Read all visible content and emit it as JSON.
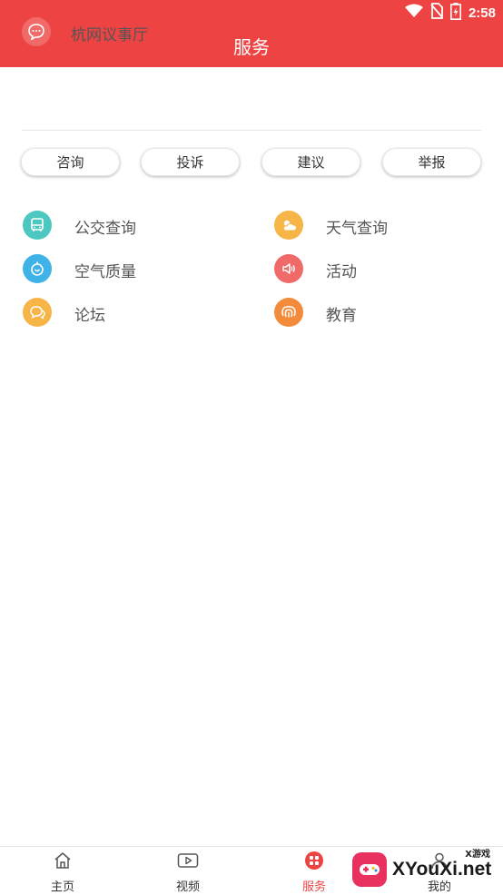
{
  "status_bar": {
    "time": "2:58"
  },
  "header": {
    "title": "服务"
  },
  "hall": {
    "label": "杭网议事厅",
    "icon": "chat-bubble-icon",
    "color": "#f06a6a"
  },
  "quick_actions": [
    {
      "label": "咨询"
    },
    {
      "label": "投诉"
    },
    {
      "label": "建议"
    },
    {
      "label": "举报"
    }
  ],
  "services": [
    {
      "label": "公交查询",
      "icon": "bus-icon",
      "color": "#4cc8c0"
    },
    {
      "label": "天气查询",
      "icon": "weather-icon",
      "color": "#f7b548"
    },
    {
      "label": "空气质量",
      "icon": "air-quality-icon",
      "color": "#3fb3e8"
    },
    {
      "label": "活动",
      "icon": "speaker-icon",
      "color": "#f06a6a"
    },
    {
      "label": "论坛",
      "icon": "forum-icon",
      "color": "#f7b548"
    },
    {
      "label": "教育",
      "icon": "education-icon",
      "color": "#f48b3b"
    }
  ],
  "tabs": [
    {
      "label": "主页",
      "icon": "home-icon"
    },
    {
      "label": "视频",
      "icon": "video-icon"
    },
    {
      "label": "服务",
      "icon": "grid-icon",
      "active": true
    },
    {
      "label": "我的",
      "icon": "profile-icon"
    }
  ],
  "watermark": {
    "text": "XYouXi.net",
    "subtext": "X游戏"
  },
  "colors": {
    "primary": "#ee4343",
    "active_tab": "#ee4343"
  }
}
